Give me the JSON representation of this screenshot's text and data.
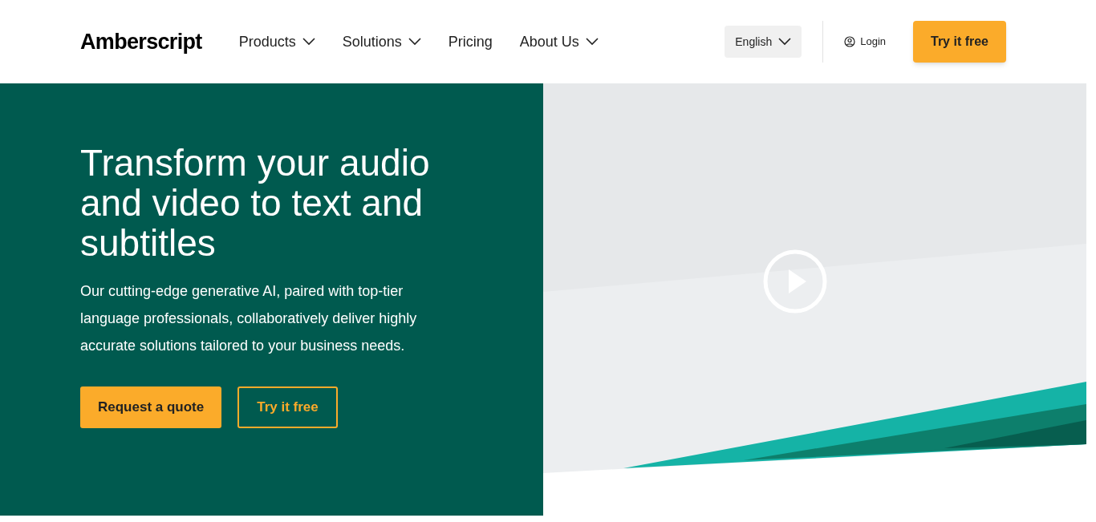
{
  "header": {
    "logo": "Amberscript",
    "nav": [
      {
        "label": "Products",
        "dropdown": true
      },
      {
        "label": "Solutions",
        "dropdown": true
      },
      {
        "label": "Pricing",
        "dropdown": false
      },
      {
        "label": "About Us",
        "dropdown": true
      }
    ],
    "language": "English",
    "login": "Login",
    "cta": "Try it free"
  },
  "hero": {
    "title": "Transform your audio and video to text and subtitles",
    "text": "Our cutting-edge generative AI, paired with top-tier language professionals, collaboratively deliver highly accurate solutions tailored to your business needs.",
    "buttons": [
      {
        "label": "Request a quote",
        "kind": "primary"
      },
      {
        "label": "Try it free",
        "kind": "outline"
      }
    ]
  }
}
